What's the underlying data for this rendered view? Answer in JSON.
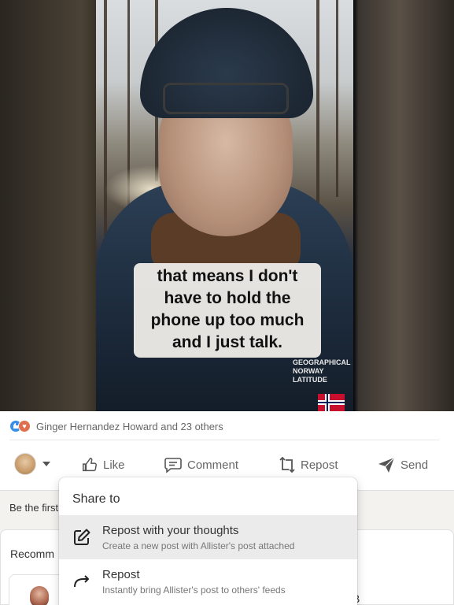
{
  "video": {
    "caption_lines": [
      "that means I don't",
      "have to hold the",
      "phone up too much",
      "and I just talk."
    ],
    "jacket_brand": [
      "GEOGRAPHICAL",
      "NORWAY",
      "LATITUDE"
    ]
  },
  "post": {
    "reactions_text": "Ginger Hernandez Howard and 23 others",
    "actions": {
      "like": "Like",
      "comment": "Comment",
      "repost": "Repost",
      "send": "Send"
    }
  },
  "comments": {
    "prompt_partial": "Be the first"
  },
  "recommended": {
    "title_partial": "Recomm",
    "trailing_letter": "B"
  },
  "share_menu": {
    "title": "Share to",
    "items": [
      {
        "label": "Repost with your thoughts",
        "description": "Create a new post with Allister's post attached",
        "icon": "pencil-square-icon"
      },
      {
        "label": "Repost",
        "description": "Instantly bring Allister's post to others' feeds",
        "icon": "forward-arrow-icon"
      }
    ]
  },
  "colors": {
    "accent_like": "#378fe9",
    "accent_love": "#df704d",
    "muted_text": "#666666",
    "menu_hover": "#ebebeb"
  }
}
